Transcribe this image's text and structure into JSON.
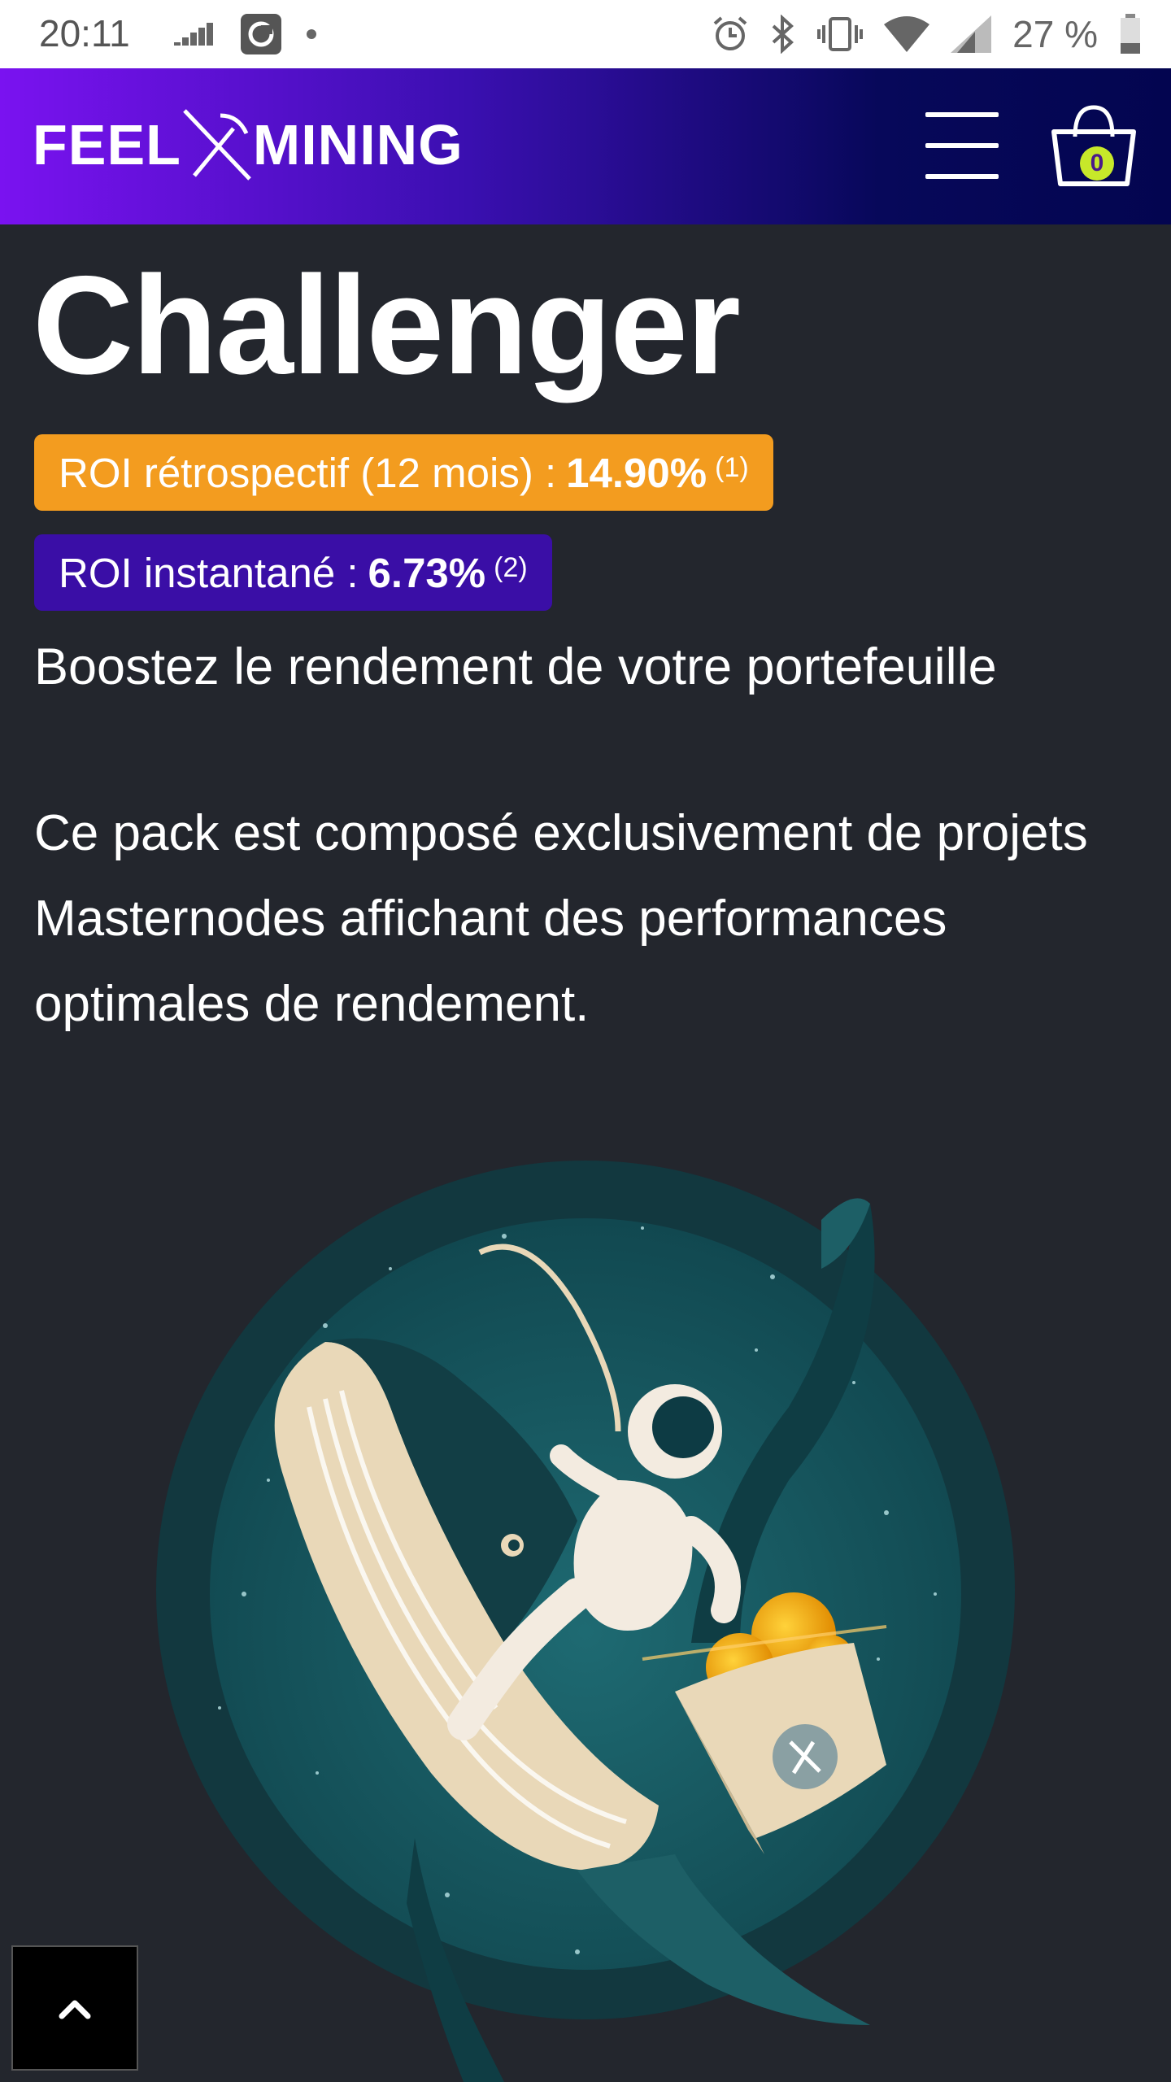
{
  "status_bar": {
    "time": "20:11",
    "battery": "27 %",
    "icons": [
      "signal-bars-icon",
      "app-icon",
      "dot-icon",
      "alarm-icon",
      "bluetooth-icon",
      "vibrate-icon",
      "wifi-icon",
      "cell-signal-icon",
      "battery-icon"
    ]
  },
  "header": {
    "logo_left": "FEEL",
    "logo_right": "MINING",
    "cart_count": "0",
    "menu_icon": "hamburger-icon",
    "cart_icon": "shopping-basket-icon"
  },
  "product": {
    "title": "Challenger",
    "roi_retro_label": "ROI rétrospectif (12 mois) :",
    "roi_retro_value": "14.90%",
    "roi_retro_note": "(1)",
    "roi_instant_label": "ROI instantané :",
    "roi_instant_value": "6.73%",
    "roi_instant_note": "(2)",
    "subtitle": "Boostez le rendement de votre portefeuille",
    "description": "Ce pack est composé exclusivement de projets Masternodes affichant des performances optimales de rendement."
  },
  "colors": {
    "background": "#23262d",
    "badge_orange": "#f39c1f",
    "badge_purple": "#3a0ea6",
    "header_gradient_start": "#7a12f0",
    "header_gradient_end": "#030550",
    "cart_badge": "#c7e82a"
  },
  "scroll_top_icon": "chevron-up-icon"
}
